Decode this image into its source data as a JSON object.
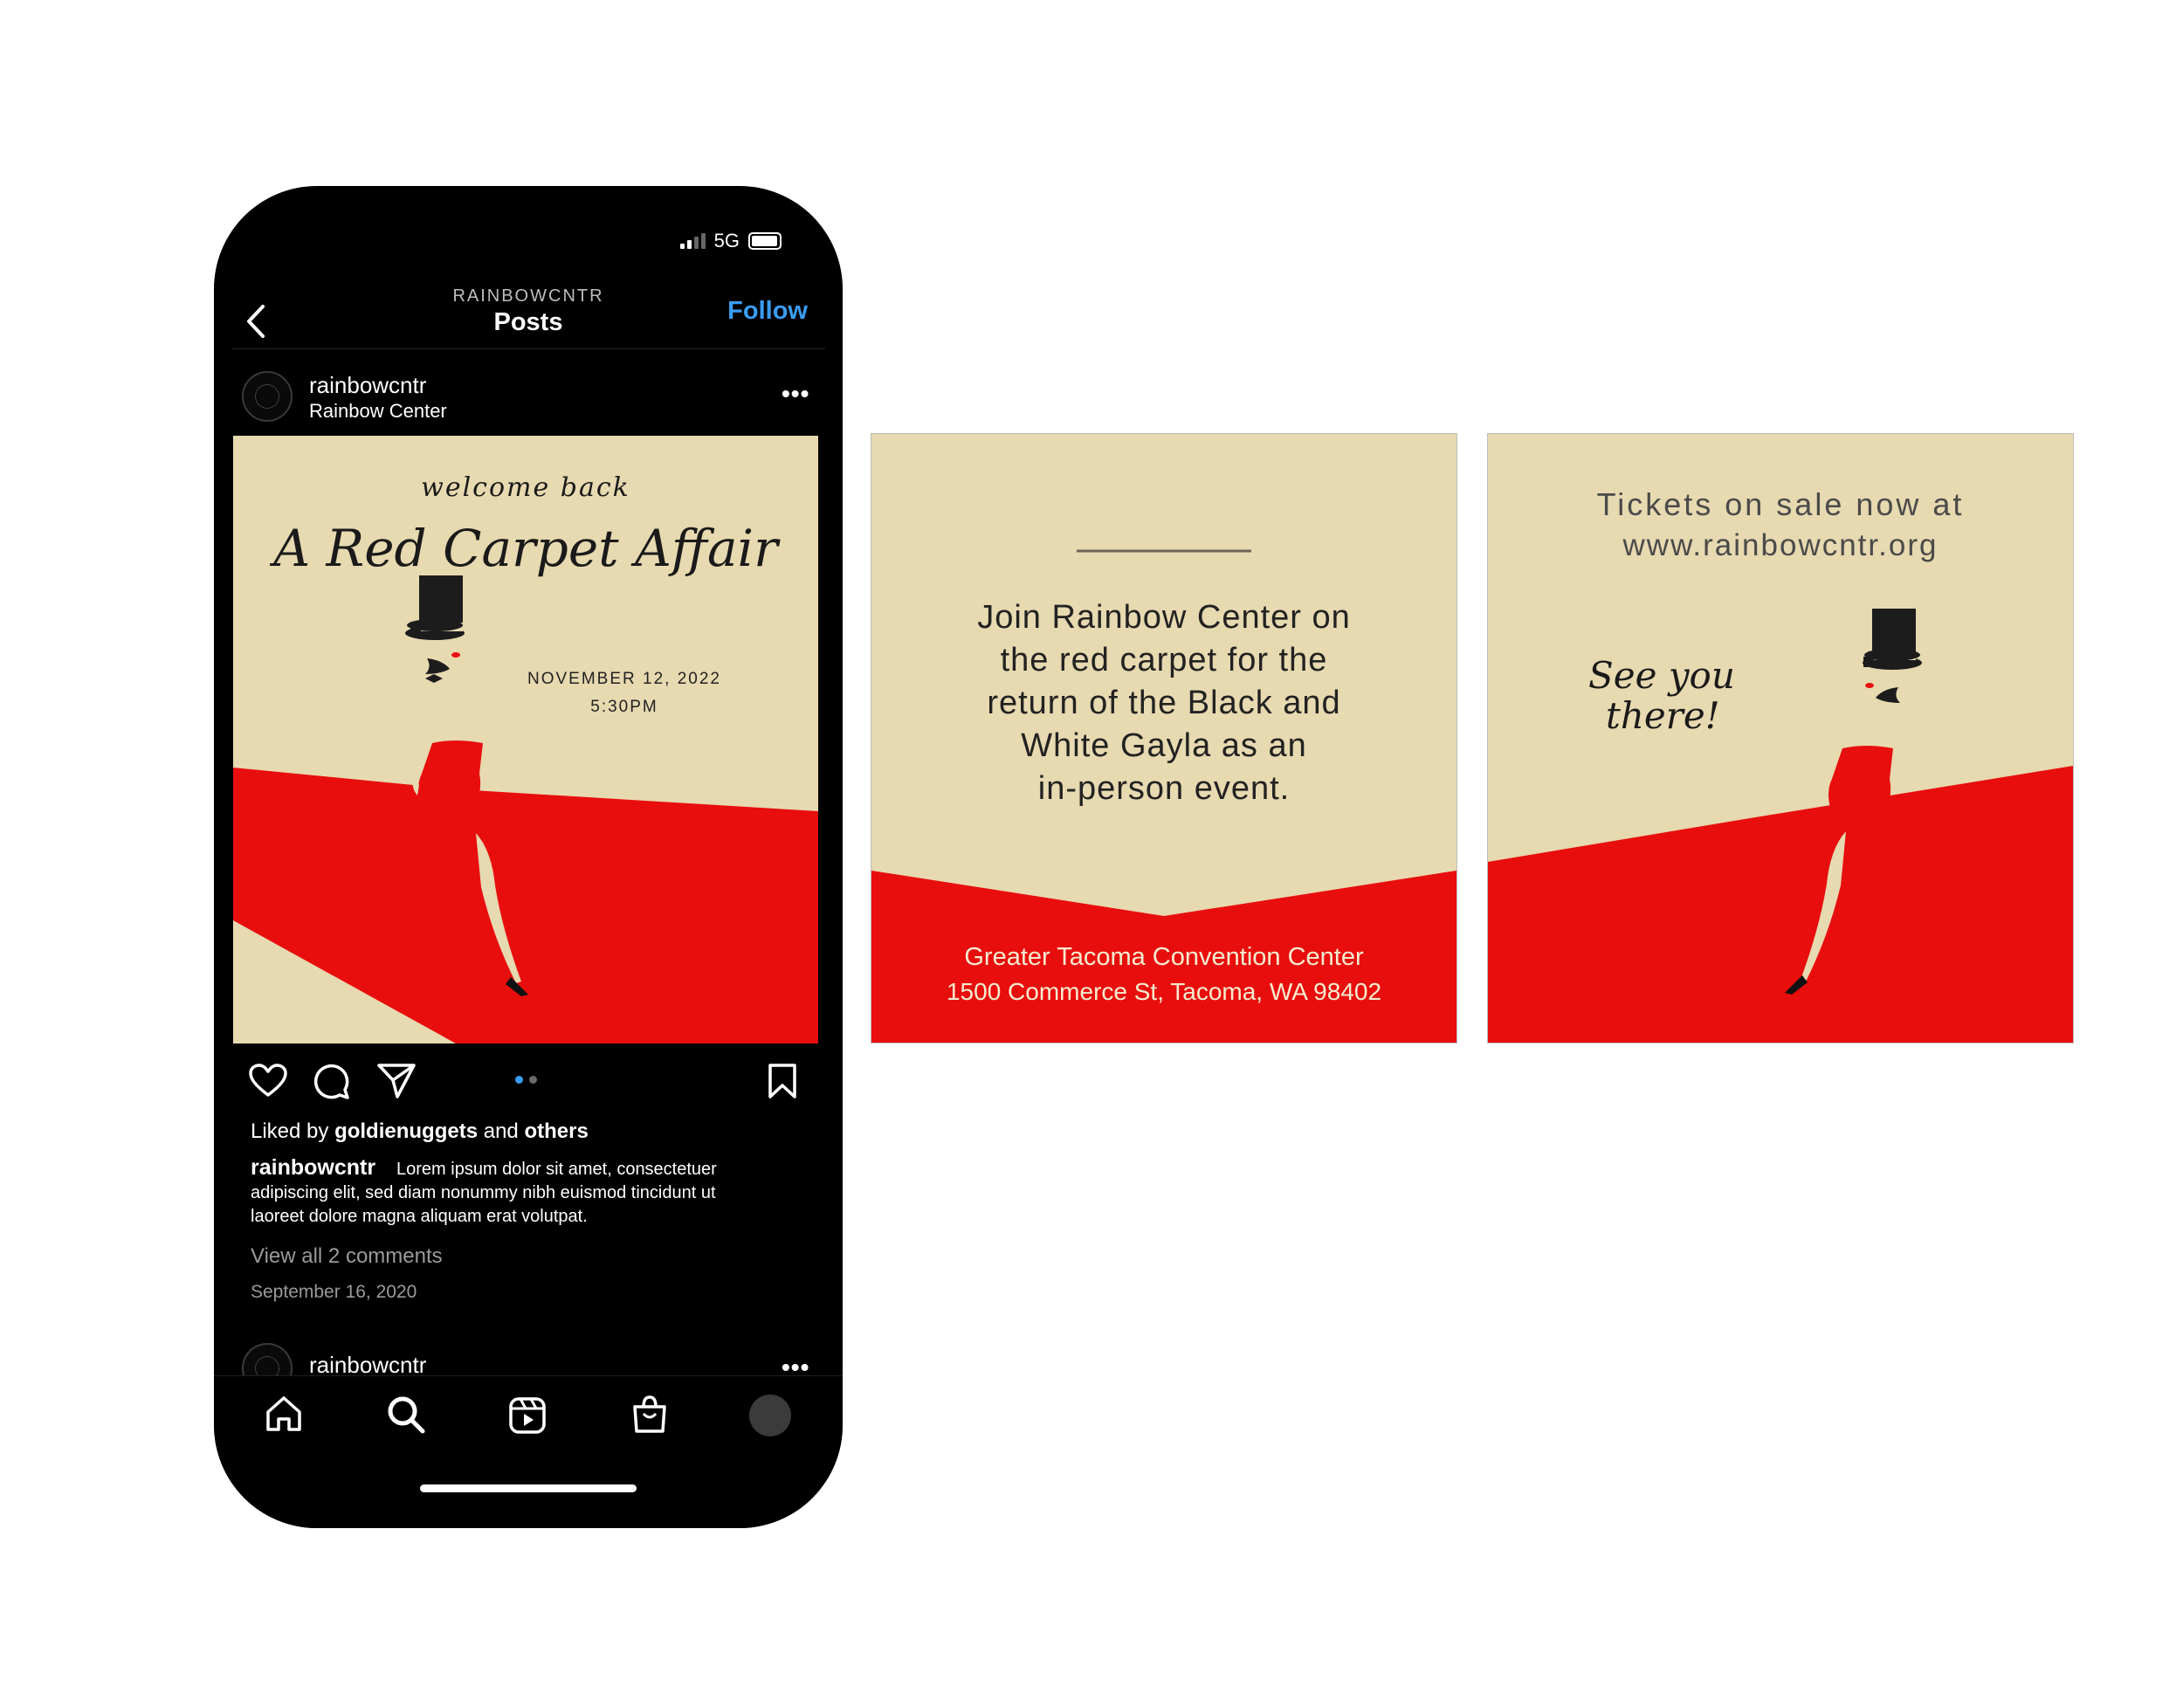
{
  "status_bar": {
    "network": "5G"
  },
  "header": {
    "account": "RAINBOWCNTR",
    "title": "Posts",
    "follow_label": "Follow"
  },
  "post": {
    "username": "rainbowcntr",
    "display_name": "Rainbow Center",
    "image": {
      "welcome": "welcome back",
      "title": "A Red Carpet Affair",
      "date": "NOVEMBER 12, 2022",
      "time": "5:30PM"
    },
    "liked_by_prefix": "Liked by",
    "liked_by_user": "goldienuggets",
    "liked_by_and": "and",
    "liked_by_others": "others",
    "caption_user": "rainbowcntr",
    "caption_line1": "Lorem ipsum dolor sit amet, consectetuer",
    "caption_line2": "adipiscing elit, sed diam nonummy nibh euismod tincidunt ut",
    "caption_line3": "laoreet dolore magna aliquam erat volutpat.",
    "view_comments": "View all 2 comments",
    "date": "September 16, 2020",
    "carousel": {
      "count": 2,
      "active": 1
    }
  },
  "next_post": {
    "username": "rainbowcntr"
  },
  "slide2": {
    "body_lines": [
      "Join Rainbow Center on",
      "the red carpet for the",
      "return of the Black and",
      "White Gayla as an",
      "in-person event."
    ],
    "venue": "Greater Tacoma Convention Center",
    "address": "1500 Commerce St, Tacoma, WA 98402"
  },
  "slide3": {
    "tickets_line1": "Tickets on sale now at",
    "tickets_line2": "www.rainbowcntr.org",
    "see_you_line1": "See you",
    "see_you_line2": "there!"
  },
  "colors": {
    "cream": "#e7d9b0",
    "red": "#e80e0e",
    "follow_blue": "#3a9cf2",
    "phone_bg": "#000000"
  },
  "icons": [
    "signal-icon",
    "battery-icon",
    "back-chevron-icon",
    "more-icon",
    "heart-icon",
    "comment-icon",
    "share-icon",
    "bookmark-icon",
    "home-icon",
    "search-icon",
    "reels-icon",
    "shop-icon",
    "profile-icon"
  ]
}
